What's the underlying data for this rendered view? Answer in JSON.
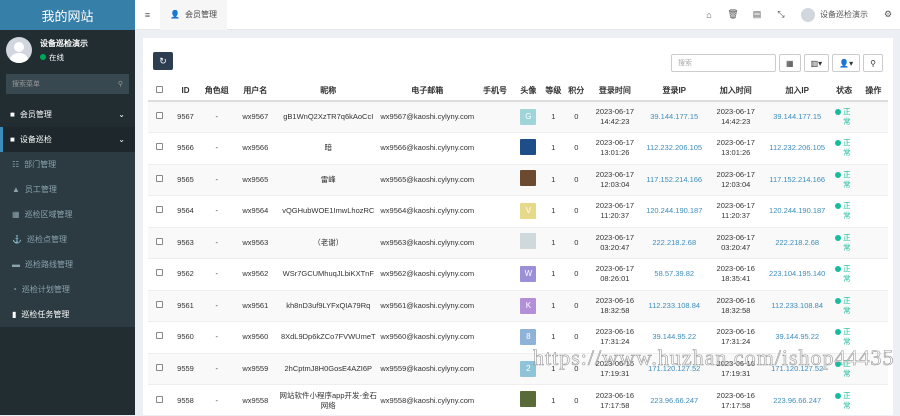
{
  "sidebar": {
    "site_title": "我的网站",
    "user_name": "设备巡检演示",
    "user_status": "在线",
    "search_placeholder": "搜索菜单",
    "menu": [
      {
        "label": "会员管理",
        "icon": "■"
      },
      {
        "label": "设备巡检",
        "icon": "■"
      }
    ],
    "submenu": [
      {
        "label": "部门管理",
        "icon": "☷"
      },
      {
        "label": "员工管理",
        "icon": "▲"
      },
      {
        "label": "巡检区域管理",
        "icon": "▦"
      },
      {
        "label": "巡检点管理",
        "icon": "⚓"
      },
      {
        "label": "巡检路线管理",
        "icon": "▬"
      },
      {
        "label": "巡检计划管理",
        "icon": "◔"
      },
      {
        "label": "巡检任务管理",
        "icon": "▮"
      }
    ]
  },
  "topbar": {
    "menu_icon": "≡",
    "tab_label": "会员管理",
    "user_name": "设备巡检演示"
  },
  "toolbar": {
    "refresh": "↻",
    "search_placeholder": "搜索"
  },
  "table": {
    "columns": [
      "ID",
      "角色组",
      "用户名",
      "昵称",
      "电子邮箱",
      "手机号",
      "头像",
      "等级",
      "积分",
      "登录时间",
      "登录IP",
      "加入时间",
      "加入IP",
      "状态",
      "操作"
    ],
    "status_label": "正常",
    "rows": [
      {
        "id": "9567",
        "group": "-",
        "username": "wx9567",
        "nickname": "gB1WnQ2XzTR7q6kAoCcI",
        "email": "wx9567@kaoshi.cylyny.com",
        "phone": "",
        "avatar": "G",
        "avatar_color": "#9fd4d8",
        "level": "1",
        "score": "0",
        "login_time": "2023-06-17 14:42:23",
        "login_ip": "39.144.177.15",
        "join_time": "2023-06-17 14:42:23",
        "join_ip": "39.144.177.15"
      },
      {
        "id": "9566",
        "group": "-",
        "username": "wx9566",
        "nickname": "暗",
        "email": "wx9566@kaoshi.cylyny.com",
        "phone": "",
        "avatar": "",
        "avatar_color": "#1f4d8a",
        "level": "1",
        "score": "0",
        "login_time": "2023-06-17 13:01:26",
        "login_ip": "112.232.206.105",
        "join_time": "2023-06-17 13:01:26",
        "join_ip": "112.232.206.105"
      },
      {
        "id": "9565",
        "group": "-",
        "username": "wx9565",
        "nickname": "雷峰",
        "email": "wx9565@kaoshi.cylyny.com",
        "phone": "",
        "avatar": "",
        "avatar_color": "#6b4a2f",
        "level": "1",
        "score": "0",
        "login_time": "2023-06-17 12:03:04",
        "login_ip": "117.152.214.166",
        "join_time": "2023-06-17 12:03:04",
        "join_ip": "117.152.214.166"
      },
      {
        "id": "9564",
        "group": "-",
        "username": "wx9564",
        "nickname": "vQGHubWOE1ImwLhozRC",
        "email": "wx9564@kaoshi.cylyny.com",
        "phone": "",
        "avatar": "V",
        "avatar_color": "#e6d98a",
        "level": "1",
        "score": "0",
        "login_time": "2023-06-17 11:20:37",
        "login_ip": "120.244.190.187",
        "join_time": "2023-06-17 11:20:37",
        "join_ip": "120.244.190.187"
      },
      {
        "id": "9563",
        "group": "-",
        "username": "wx9563",
        "nickname": "（老谢）",
        "email": "wx9563@kaoshi.cylyny.com",
        "phone": "",
        "avatar": "",
        "avatar_color": "#cfd8dc",
        "level": "1",
        "score": "0",
        "login_time": "2023-06-17 03:20:47",
        "login_ip": "222.218.2.68",
        "join_time": "2023-06-17 03:20:47",
        "join_ip": "222.218.2.68"
      },
      {
        "id": "9562",
        "group": "-",
        "username": "wx9562",
        "nickname": "WSr7GCUMhuqJLbiKXTnF",
        "email": "wx9562@kaoshi.cylyny.com",
        "phone": "",
        "avatar": "W",
        "avatar_color": "#9b8fd8",
        "level": "1",
        "score": "0",
        "login_time": "2023-06-17 08:26:01",
        "login_ip": "58.57.39.82",
        "join_time": "2023-06-16 18:35:41",
        "join_ip": "223.104.195.140"
      },
      {
        "id": "9561",
        "group": "-",
        "username": "wx9561",
        "nickname": "kh8nD3uf9LYFxQIA79Rq",
        "email": "wx9561@kaoshi.cylyny.com",
        "phone": "",
        "avatar": "K",
        "avatar_color": "#b38fd8",
        "level": "1",
        "score": "0",
        "login_time": "2023-06-16 18:32:58",
        "login_ip": "112.233.108.84",
        "join_time": "2023-06-16 18:32:58",
        "join_ip": "112.233.108.84"
      },
      {
        "id": "9560",
        "group": "-",
        "username": "wx9560",
        "nickname": "8XdL9Dp6kZCo7FVWUmeT",
        "email": "wx9560@kaoshi.cylyny.com",
        "phone": "",
        "avatar": "8",
        "avatar_color": "#8fb3d8",
        "level": "1",
        "score": "0",
        "login_time": "2023-06-16 17:31:24",
        "login_ip": "39.144.95.22",
        "join_time": "2023-06-16 17:31:24",
        "join_ip": "39.144.95.22"
      },
      {
        "id": "9559",
        "group": "-",
        "username": "wx9559",
        "nickname": "2hCptmJ8H0GosE4AZI6P",
        "email": "wx9559@kaoshi.cylyny.com",
        "phone": "",
        "avatar": "2",
        "avatar_color": "#8fc4d8",
        "level": "1",
        "score": "0",
        "login_time": "2023-06-16 17:19:31",
        "login_ip": "171.120.127.52",
        "join_time": "2023-06-16 17:19:31",
        "join_ip": "171.120.127.52"
      },
      {
        "id": "9558",
        "group": "-",
        "username": "wx9558",
        "nickname": "网站软件小程序app开发-金石网络",
        "email": "wx9558@kaoshi.cylyny.com",
        "phone": "",
        "avatar": "",
        "avatar_color": "#5a6b3a",
        "level": "1",
        "score": "0",
        "login_time": "2023-06-16 17:17:58",
        "login_ip": "223.96.66.247",
        "join_time": "2023-06-16 17:17:58",
        "join_ip": "223.96.66.247"
      }
    ]
  },
  "watermark": "https://www.huzhan.com/ishop44435"
}
